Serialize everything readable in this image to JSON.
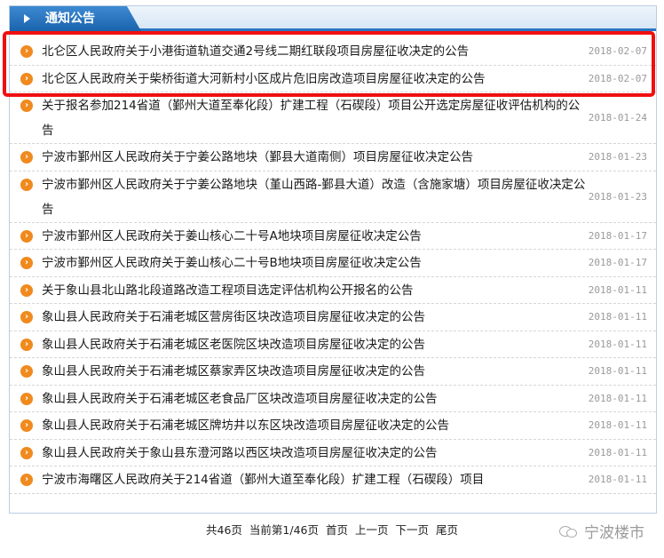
{
  "header": {
    "title": "通知公告"
  },
  "notices": [
    {
      "title": "北仑区人民政府关于小港街道轨道交通2号线二期红联段项目房屋征收决定的公告",
      "date": "2018-02-07"
    },
    {
      "title": "北仑区人民政府关于柴桥街道大河新村小区成片危旧房改造项目房屋征收决定的公告",
      "date": "2018-02-07"
    },
    {
      "title": "关于报名参加214省道（鄞州大道至奉化段）扩建工程（石碶段）项目公开选定房屋征收评估机构的公告",
      "date": "2018-01-24"
    },
    {
      "title": "宁波市鄞州区人民政府关于宁姜公路地块（鄞县大道南侧）项目房屋征收决定公告",
      "date": "2018-01-23"
    },
    {
      "title": "宁波市鄞州区人民政府关于宁姜公路地块（堇山西路-鄞县大道）改造（含施家塘）项目房屋征收决定公告",
      "date": "2018-01-23"
    },
    {
      "title": "宁波市鄞州区人民政府关于姜山核心二十号A地块项目房屋征收决定公告",
      "date": "2018-01-17"
    },
    {
      "title": "宁波市鄞州区人民政府关于姜山核心二十号B地块项目房屋征收决定公告",
      "date": "2018-01-17"
    },
    {
      "title": "关于象山县北山路北段道路改造工程项目选定评估机构公开报名的公告",
      "date": "2018-01-11"
    },
    {
      "title": "象山县人民政府关于石浦老城区营房街区块改造项目房屋征收决定的公告",
      "date": "2018-01-11"
    },
    {
      "title": "象山县人民政府关于石浦老城区老医院区块改造项目房屋征收决定的公告",
      "date": "2018-01-11"
    },
    {
      "title": "象山县人民政府关于石浦老城区蔡家弄区块改造项目房屋征收决定的公告",
      "date": "2018-01-11"
    },
    {
      "title": "象山县人民政府关于石浦老城区老食品厂区块改造项目房屋征收决定的公告",
      "date": "2018-01-11"
    },
    {
      "title": "象山县人民政府关于石浦老城区牌坊井以东区块改造项目房屋征收决定的公告",
      "date": "2018-01-11"
    },
    {
      "title": "象山县人民政府关于象山县东澄河路以西区块改造项目房屋征收决定的公告",
      "date": "2018-01-11"
    },
    {
      "title": "宁波市海曙区人民政府关于214省道（鄞州大道至奉化段）扩建工程（石碶段）项目",
      "date": "2018-01-11"
    }
  ],
  "pager": {
    "total": "共46页",
    "current": "当前第1/46页",
    "first": "首页",
    "prev": "上一页",
    "next": "下一页",
    "last": "尾页"
  },
  "watermark": {
    "text": "宁波楼市"
  },
  "colors": {
    "accent": "#1a63ad",
    "bullet": "#f08a1e",
    "highlight": "#f01010"
  }
}
